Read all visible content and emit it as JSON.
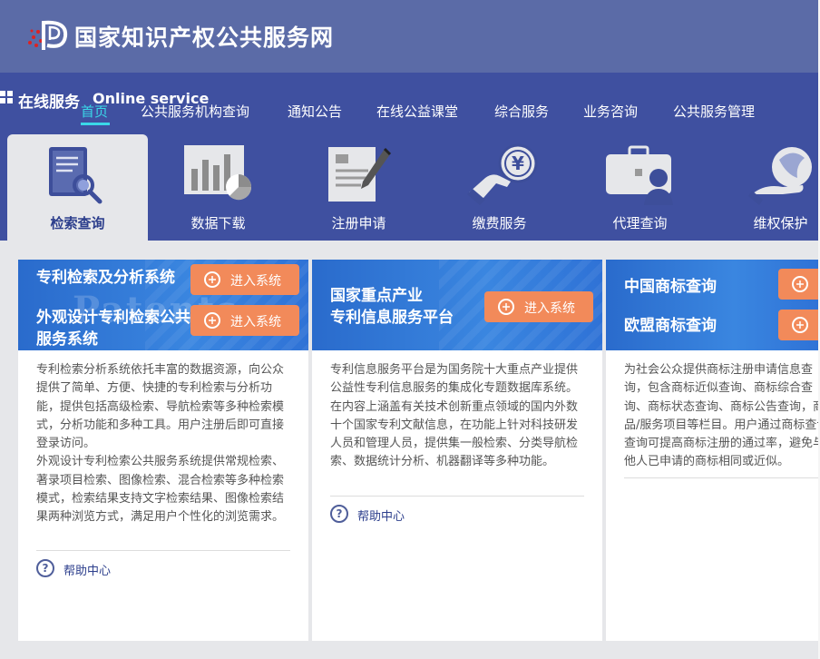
{
  "header": {
    "site_title": "国家知识产权公共服务网"
  },
  "section": {
    "title": "在线服务",
    "title_en": "Online service"
  },
  "nav": {
    "items": [
      {
        "label": "首页",
        "active": true
      },
      {
        "label": "公共服务机构查询"
      },
      {
        "label": "通知公告"
      },
      {
        "label": "在线公益课堂"
      },
      {
        "label": "综合服务"
      },
      {
        "label": "业务咨询"
      },
      {
        "label": "公共服务管理"
      }
    ]
  },
  "service_tabs": [
    {
      "label": "检索查询",
      "icon": "search-document-icon",
      "active": true
    },
    {
      "label": "数据下载",
      "icon": "chart-icon"
    },
    {
      "label": "注册申请",
      "icon": "form-pen-icon"
    },
    {
      "label": "缴费服务",
      "icon": "payment-hand-icon"
    },
    {
      "label": "代理查询",
      "icon": "briefcase-person-icon"
    },
    {
      "label": "维权保护",
      "icon": "shield-hand-icon"
    }
  ],
  "cards": [
    {
      "banner_titles": [
        "专利检索及分析系统",
        "外观设计专利检索公共服务系统"
      ],
      "banner_text": "Patents",
      "enter_label": "进入系统",
      "description": "专利检索分析系统依托丰富的数据资源，向公众提供了简单、方便、快捷的专利检索与分析功能，提供包括高级检索、导航检索等多种检索模式，分析功能和多种工具。用户注册后即可直接登录访问。\n外观设计专利检索公共服务系统提供常规检索、著录项目检索、图像检索、混合检索等多种检索模式，检索结果支持文字检索结果、图像检索结果两种浏览方式，满足用户个性化的浏览需求。",
      "help_label": "帮助中心"
    },
    {
      "banner_titles": [
        "国家重点产业\n专利信息服务平台"
      ],
      "enter_label": "进入系统",
      "description": "专利信息服务平台是为国务院十大重点产业提供公益性专利信息服务的集成化专题数据库系统。在内容上涵盖有关技术创新重点领域的国内外数十个国家专利文献信息，在功能上针对科技研发人员和管理人员，提供集一般检索、分类导航检索、数据统计分析、机器翻译等多种功能。",
      "help_label": "帮助中心"
    },
    {
      "banner_titles": [
        "中国商标查询",
        "欧盟商标查询"
      ],
      "description": "为社会公众提供商标注册申请信息查询，包含商标近似查询、商标综合查询、商标状态查询、商标公告查询，商品/服务项目等栏目。用户通过商标查询查询可提高商标注册的通过率，避免与他人已申请的商标相同或近似。"
    }
  ]
}
